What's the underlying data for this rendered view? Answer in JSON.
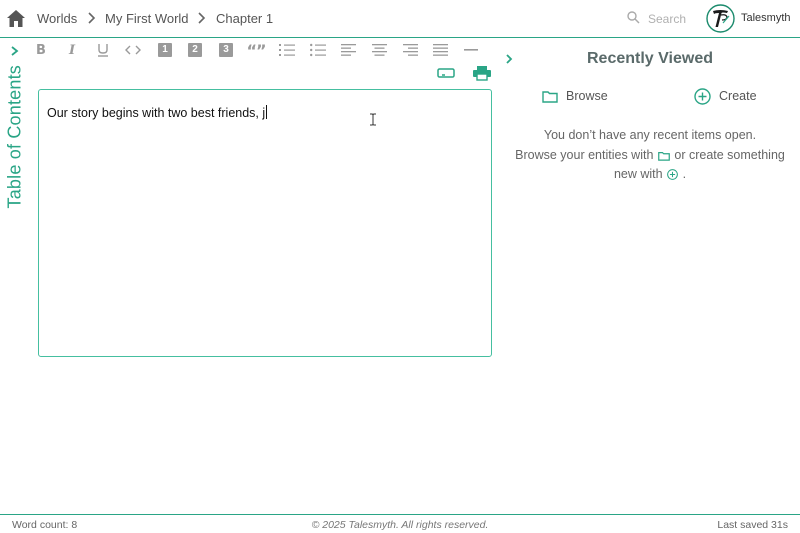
{
  "breadcrumbs": [
    "Worlds",
    "My First World",
    "Chapter 1"
  ],
  "search": {
    "placeholder": "Search"
  },
  "brand": {
    "name": "Talesmyth"
  },
  "toc": {
    "label": "Table of Contents"
  },
  "toolbar": {
    "bold": "B",
    "italic": "I",
    "heading1": "1",
    "heading2": "2",
    "heading3": "3",
    "quote": "“”"
  },
  "editor": {
    "text": "Our story begins with two best friends, j"
  },
  "recent": {
    "title": "Recently Viewed",
    "browse_label": "Browse",
    "create_label": "Create",
    "empty_line1": "You don’t have any recent items open.",
    "empty_line2_a": "Browse your entities with",
    "empty_line2_b": "or create something",
    "empty_line3": "new with"
  },
  "footer": {
    "word_count": "Word count: 8",
    "copyright": "© 2025 Talesmyth. All rights reserved.",
    "last_saved": "Last saved 31s"
  },
  "colors": {
    "accent": "#2aa586",
    "toolbar_icon": "#9a9a9a",
    "title": "#5a6a6a"
  },
  "icons": [
    "home-icon",
    "chevron-right-icon",
    "search-icon",
    "talesmyth-logo",
    "folder-icon",
    "plus-circle-icon",
    "print-icon",
    "link-card-icon",
    "text-cursor-icon"
  ]
}
